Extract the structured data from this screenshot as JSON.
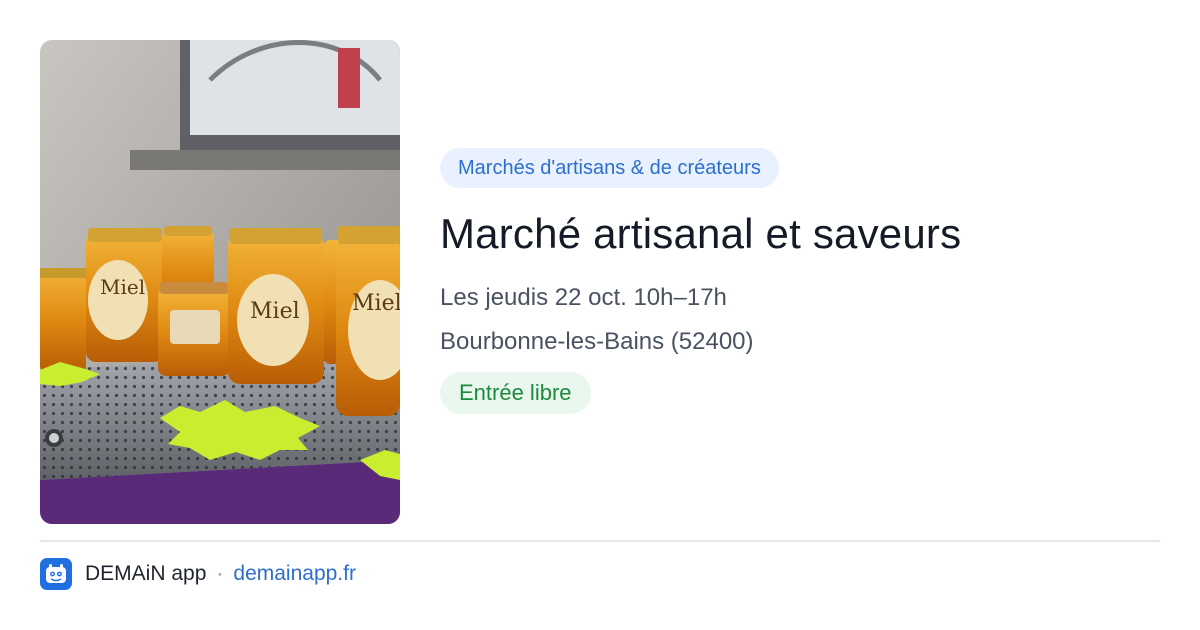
{
  "event": {
    "category": "Marchés d'artisans & de créateurs",
    "title": "Marché artisanal et saveurs",
    "dates": "Les jeudis 22 oct. 10h–17h",
    "location": "Bourbonne-les-Bains (52400)",
    "price": "Entrée libre"
  },
  "photo": {
    "jar_label": "Miel",
    "icon": "honey-jars-photo"
  },
  "footer": {
    "app_name": "DEMAiN app",
    "separator": "·",
    "url": "demainapp.fr",
    "icon": "demain-app-icon"
  },
  "colors": {
    "accent": "#2c6fce",
    "category_bg": "#e8f1fd",
    "price_text": "#1d8a3e",
    "price_bg": "#eaf7ee",
    "title": "#141a26"
  }
}
